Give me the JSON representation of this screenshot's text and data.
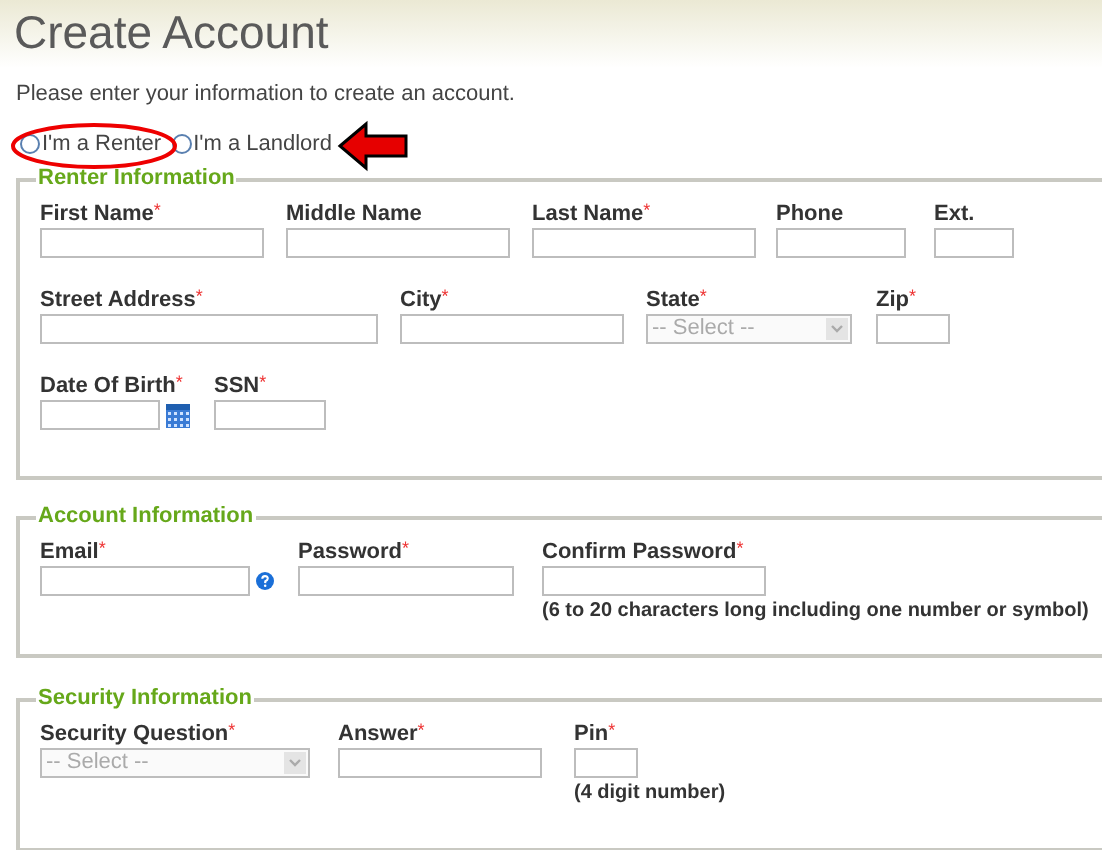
{
  "page": {
    "title": "Create Account",
    "intro": "Please enter your information to create an account."
  },
  "account_type": [
    {
      "label": "I'm a Renter",
      "selected": false
    },
    {
      "label": "I'm a Landlord",
      "selected": false
    }
  ],
  "sections": [
    {
      "legend": "Renter Information",
      "rows": [
        [
          {
            "label": "First Name",
            "marker": "*",
            "kind": "text"
          },
          {
            "label": "Middle Name",
            "kind": "text"
          },
          {
            "label": "Last Name",
            "marker": "*",
            "kind": "text"
          },
          {
            "label": "Phone",
            "kind": "text"
          },
          {
            "label": "Ext.",
            "kind": "text"
          }
        ],
        [
          {
            "label": "Street Address",
            "marker": "*",
            "kind": "text"
          },
          {
            "label": "City",
            "marker": "*",
            "kind": "text"
          },
          {
            "label": "State",
            "marker": "*",
            "kind": "select",
            "value": "-- Select --"
          },
          {
            "label": "Zip",
            "marker": "*",
            "kind": "text"
          }
        ],
        [
          {
            "label": "Date Of Birth",
            "marker": "*",
            "kind": "date"
          },
          {
            "label": "SSN",
            "marker": "*",
            "kind": "text"
          }
        ]
      ]
    },
    {
      "legend": "Account Information",
      "rows": [
        [
          {
            "label": "Email",
            "marker": "*",
            "kind": "help"
          },
          {
            "label": "Password",
            "marker": "*",
            "kind": "text"
          },
          {
            "label": "Confirm Password",
            "marker": "*",
            "kind": "text",
            "note": "(6 to 20 characters long including one number or symbol)"
          }
        ]
      ]
    },
    {
      "legend": "Security Information",
      "rows": [
        [
          {
            "label": "Security Question",
            "marker": "*",
            "kind": "select",
            "value": "-- Select --"
          },
          {
            "label": "Answer",
            "marker": "*",
            "kind": "text"
          },
          {
            "label": "Pin",
            "marker": "*",
            "kind": "text",
            "note": "(4 digit number)"
          }
        ]
      ]
    }
  ]
}
